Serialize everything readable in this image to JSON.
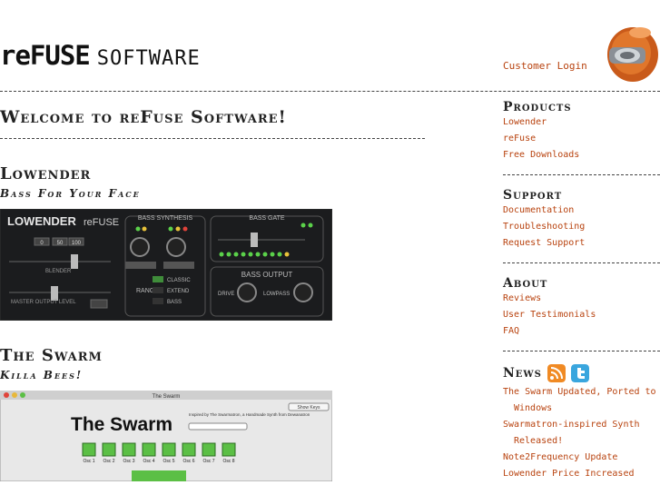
{
  "header": {
    "logo_main": "reFUSE",
    "logo_sub": "SOFTWARE",
    "login_link": "Customer Login"
  },
  "main": {
    "welcome": "Welcome to reFuse Software!",
    "products": [
      {
        "title": "Lowender",
        "tagline": "Bass For Your Face"
      },
      {
        "title": "The Swarm",
        "tagline": "Killa Bees!"
      }
    ],
    "lowender_ui": {
      "brand": "LOWENDER",
      "maker": "reFUSE",
      "synth_label": "BASS SYNTHESIS",
      "gate_label": "BASS GATE",
      "output_label": "BASS OUTPUT",
      "range_label": "RANGE",
      "range_options": [
        "CLASSIC",
        "EXTEND",
        "BASS"
      ],
      "drive_label": "DRIVE",
      "lowpass_label": "LOWPASS",
      "blender_label": "BLENDER",
      "master_label": "MASTER OUTPUT LEVEL",
      "presets": [
        "0",
        "50",
        "100"
      ]
    },
    "swarm_ui": {
      "window_title": "The Swarm",
      "app_title": "The Swarm",
      "credit": "Inspired by The Swarmatron, a Handmade Synth from Dewanatron",
      "button": "Show Keys",
      "oscillators": [
        "Osc 1",
        "Osc 2",
        "Osc 3",
        "Osc 4",
        "Osc 5",
        "Osc 6",
        "Osc 7",
        "Osc 8"
      ]
    }
  },
  "sidebar": {
    "products": {
      "title": "Products",
      "links": [
        "Lowender",
        "reFuse",
        "Free Downloads"
      ]
    },
    "support": {
      "title": "Support",
      "links": [
        "Documentation",
        "Troubleshooting",
        "Request Support"
      ]
    },
    "about": {
      "title": "About",
      "links": [
        "Reviews",
        "User Testimonials",
        "FAQ"
      ]
    },
    "news": {
      "title": "News",
      "links": [
        "The Swarm Updated, Ported to Windows",
        "Swarmatron-inspired Synth Released!",
        "Note2Frequency Update",
        "Lowender Price Increased"
      ]
    }
  },
  "colors": {
    "link": "#b8420e",
    "rss": "#f08a24",
    "twitter": "#3aa6de"
  }
}
